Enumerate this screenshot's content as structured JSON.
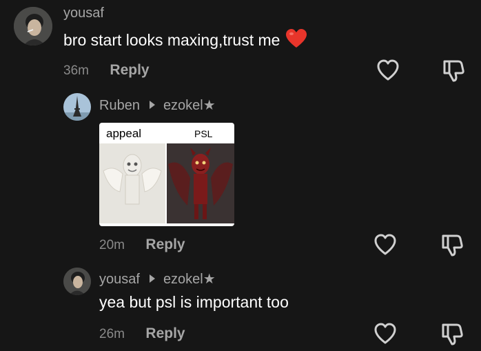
{
  "comments": [
    {
      "username": "yousaf",
      "text": "bro start looks maxing,trust me",
      "emoji": "heart",
      "time": "36m",
      "reply_label": "Reply"
    },
    {
      "username": "Ruben",
      "reply_to": "ezokel★",
      "meme": {
        "left_label": "appeal",
        "right_label": "PSL"
      },
      "time": "20m",
      "reply_label": "Reply"
    },
    {
      "username": "yousaf",
      "reply_to": "ezokel★",
      "text": "yea but psl is important too",
      "time": "26m",
      "reply_label": "Reply"
    }
  ],
  "colors": {
    "background": "#161616",
    "primary_text": "#ffffff",
    "secondary_text": "#a6a6a6",
    "emoji_heart": "#e8352b"
  },
  "icons": [
    "heart-outline-icon",
    "thumbs-down-icon",
    "play-arrow-icon"
  ]
}
